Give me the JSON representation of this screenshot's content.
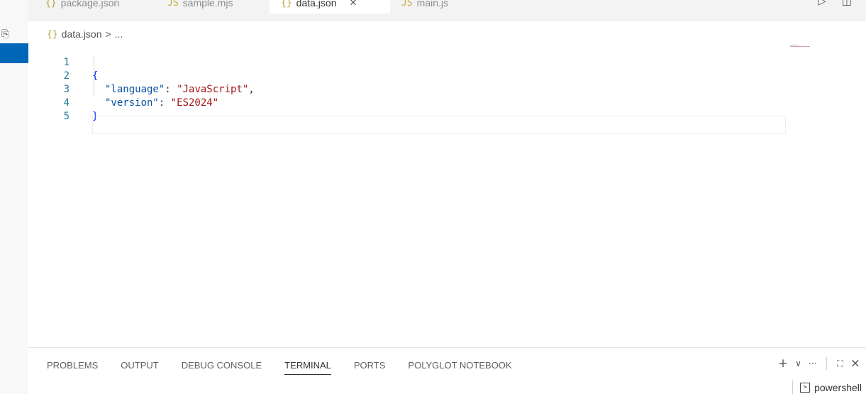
{
  "tabs": [
    {
      "icon": "{}",
      "label": "package.json"
    },
    {
      "icon": "JS",
      "label": "sample.mjs"
    },
    {
      "icon": "{}",
      "label": "data.json",
      "active": true
    },
    {
      "icon": "JS",
      "label": "main.js"
    }
  ],
  "breadcrumb": {
    "icon": "{}",
    "file": "data.json",
    "separator": ">",
    "rest": "..."
  },
  "editor": {
    "lines": [
      {
        "num": "1",
        "parts": [
          "{"
        ]
      },
      {
        "num": "2",
        "key": "\"language\"",
        "colon": ": ",
        "value": "\"JavaScript\"",
        "trail": ","
      },
      {
        "num": "3",
        "key": "\"version\"",
        "colon": ": ",
        "value": "\"ES2024\"",
        "trail": ""
      },
      {
        "num": "4",
        "parts": [
          "}"
        ]
      },
      {
        "num": "5"
      }
    ]
  },
  "panel": {
    "tabs": [
      "PROBLEMS",
      "OUTPUT",
      "DEBUG CONSOLE",
      "TERMINAL",
      "PORTS",
      "POLYGLOT NOTEBOOK"
    ],
    "active_tab": "TERMINAL",
    "actions": {
      "add": "+",
      "dropdown": "∨",
      "more": "···",
      "maximize": "⛶",
      "close": "×"
    },
    "terminal_name": "powershell"
  },
  "colors": {
    "accent": "#0066b8",
    "key": "#0451a5",
    "string": "#a31515",
    "brace": "#0431fa",
    "line_number": "#237893"
  }
}
